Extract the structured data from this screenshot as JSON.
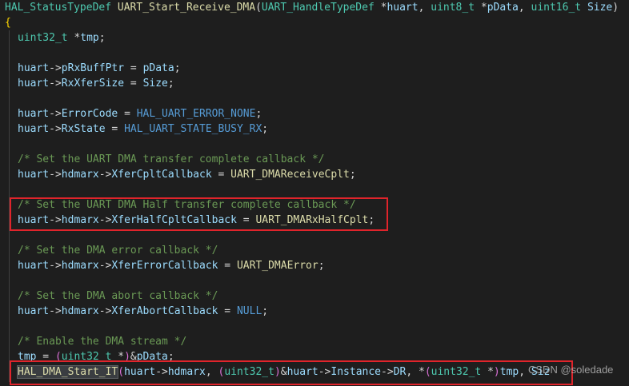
{
  "code": {
    "sig_ret": "HAL_StatusTypeDef",
    "sig_fn": "UART_Start_Receive_DMA",
    "sig_p1_type": "UART_HandleTypeDef",
    "sig_p1_name": "huart",
    "sig_p2_type": "uint8_t",
    "sig_p2_name": "pData",
    "sig_p3_type": "uint16_t",
    "sig_p3_name": "Size",
    "open_brace": "{",
    "l_tmp_type": "uint32_t",
    "l_tmp_name": "tmp",
    "huart": "huart",
    "pRxBuffPtr": "pRxBuffPtr",
    "pData": "pData",
    "RxXferSize": "RxXferSize",
    "Size": "Size",
    "ErrorCode": "ErrorCode",
    "HAL_UART_ERROR_NONE": "HAL_UART_ERROR_NONE",
    "RxState": "RxState",
    "HAL_UART_STATE_BUSY_RX": "HAL_UART_STATE_BUSY_RX",
    "comment_cplt": "/* Set the UART DMA transfer complete callback */",
    "hdmarx": "hdmarx",
    "XferCpltCallback": "XferCpltCallback",
    "UART_DMAReceiveCplt": "UART_DMAReceiveCplt",
    "comment_half": "/* Set the UART DMA Half transfer complete callback */",
    "XferHalfCpltCallback": "XferHalfCpltCallback",
    "UART_DMARxHalfCplt": "UART_DMARxHalfCplt",
    "comment_error": "/* Set the DMA error callback */",
    "XferErrorCallback": "XferErrorCallback",
    "UART_DMAError": "UART_DMAError",
    "comment_abort": "/* Set the DMA abort callback */",
    "XferAbortCallback": "XferAbortCallback",
    "NULL": "NULL",
    "comment_enable": "/* Enable the DMA stream */",
    "tmp": "tmp",
    "uint32_t": "uint32_t",
    "HAL_DMA_Start_IT": "HAL_DMA_Start_IT",
    "Instance": "Instance",
    "DR": "DR",
    "Siz_trunc": "Siz"
  },
  "highlights": {
    "box_color": "#e0242b"
  },
  "watermark": "CSDN @soledade"
}
